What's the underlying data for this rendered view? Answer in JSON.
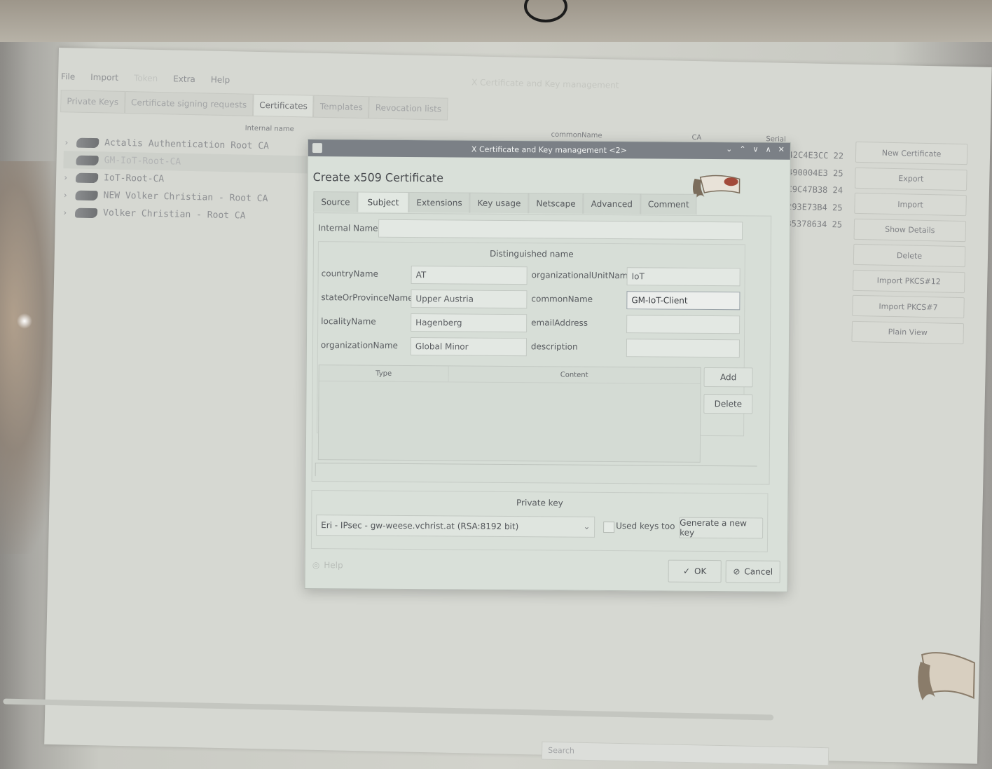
{
  "main_window": {
    "title": "X Certificate and Key management",
    "menu": [
      "File",
      "Import",
      "Token",
      "Extra",
      "Help"
    ],
    "tabs": [
      "Private Keys",
      "Certificate signing requests",
      "Certificates",
      "Templates",
      "Revocation lists"
    ],
    "active_tab": "Certificates",
    "columns": [
      "Internal name",
      "commonName",
      "CA",
      "Serial"
    ],
    "certificates": [
      {
        "name": "Actalis Authentication Root CA",
        "serial": "70A119742C4E3CC 22"
      },
      {
        "name": "GM-IoT-Root-CA",
        "serial": "E29209C490004E3 25"
      },
      {
        "name": "IoT-Root-CA",
        "serial": "0F14E5EC9C47B38 24"
      },
      {
        "name": "NEW Volker Christian - Root CA",
        "serial": "164139E293E73B4 25"
      },
      {
        "name": "Volker Christian - Root CA",
        "serial": "3DC036FB5378634 25"
      }
    ],
    "side_buttons": [
      "New Certificate",
      "Export",
      "Import",
      "Show Details",
      "Delete",
      "Import PKCS#12",
      "Import PKCS#7",
      "Plain View"
    ],
    "search_placeholder": "Search"
  },
  "dialog": {
    "window_title": "X Certificate and Key management <2>",
    "heading": "Create x509 Certificate",
    "tabs": [
      "Source",
      "Subject",
      "Extensions",
      "Key usage",
      "Netscape",
      "Advanced",
      "Comment"
    ],
    "active_tab": "Subject",
    "internal_name_label": "Internal Name",
    "internal_name_value": "",
    "dn_title": "Distinguished name",
    "fields": {
      "countryName": {
        "label": "countryName",
        "value": "AT"
      },
      "stateOrProvinceName": {
        "label": "stateOrProvinceName",
        "value": "Upper Austria"
      },
      "localityName": {
        "label": "localityName",
        "value": "Hagenberg"
      },
      "organizationName": {
        "label": "organizationName",
        "value": "Global Minor"
      },
      "organizationalUnitName": {
        "label": "organizationalUnitName",
        "value": "IoT"
      },
      "commonName": {
        "label": "commonName",
        "value": "GM-IoT-Client"
      },
      "emailAddress": {
        "label": "emailAddress",
        "value": ""
      },
      "description": {
        "label": "description",
        "value": ""
      }
    },
    "table_headers": [
      "Type",
      "Content"
    ],
    "add_label": "Add",
    "delete_label": "Delete",
    "private_key_title": "Private key",
    "private_key_value": "Eri - IPsec - gw-weese.vchrist.at (RSA:8192 bit)",
    "used_keys_label": "Used keys too",
    "generate_key_label": "Generate a new key",
    "help_label": "Help",
    "ok_label": "OK",
    "cancel_label": "Cancel"
  }
}
